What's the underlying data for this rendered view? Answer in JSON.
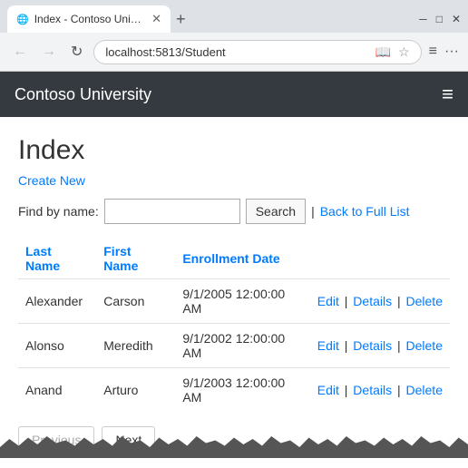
{
  "browser": {
    "tab_title": "Index - Contoso Univers...",
    "url": "localhost:5813/Student",
    "new_tab_label": "+",
    "back_btn": "←",
    "forward_btn": "→",
    "refresh_btn": "↻",
    "menu_btn": "≡",
    "more_btn": "···",
    "window_minimize": "─",
    "window_maximize": "□",
    "window_close": "✕"
  },
  "header": {
    "title": "Contoso University",
    "hamburger_icon": "≡"
  },
  "page": {
    "heading": "Index",
    "create_new_label": "Create New",
    "find_by_name_label": "Find by name:",
    "search_placeholder": "",
    "search_btn_label": "Search",
    "separator": "|",
    "back_to_full_list_label": "Back to Full List"
  },
  "table": {
    "columns": [
      {
        "key": "last_name",
        "label": "Last Name"
      },
      {
        "key": "first_name",
        "label": "First Name"
      },
      {
        "key": "enrollment_date",
        "label": "Enrollment Date"
      },
      {
        "key": "actions",
        "label": ""
      }
    ],
    "rows": [
      {
        "last_name": "Alexander",
        "first_name": "Carson",
        "enrollment_date": "9/1/2005 12:00:00 AM"
      },
      {
        "last_name": "Alonso",
        "first_name": "Meredith",
        "enrollment_date": "9/1/2002 12:00:00 AM"
      },
      {
        "last_name": "Anand",
        "first_name": "Arturo",
        "enrollment_date": "9/1/2003 12:00:00 AM"
      }
    ],
    "action_edit": "Edit",
    "action_details": "Details",
    "action_delete": "Delete",
    "action_sep": "|"
  },
  "pagination": {
    "previous_label": "Previous",
    "next_label": "Next"
  }
}
